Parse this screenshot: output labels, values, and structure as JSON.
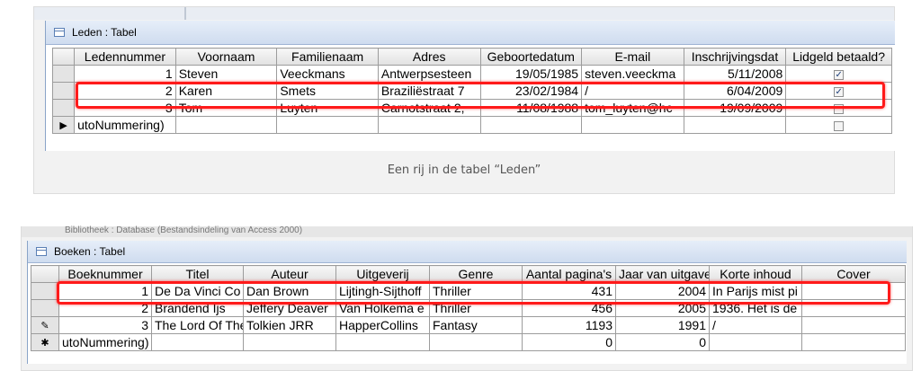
{
  "leden": {
    "window_title": "Leden : Tabel",
    "columns": [
      "Ledennummer",
      "Voornaam",
      "Familienaam",
      "Adres",
      "Geboortedatum",
      "E-mail",
      "Inschrijvingsdat",
      "Lidgeld betaald?"
    ],
    "rows": [
      {
        "nummer": "1",
        "voornaam": "Steven",
        "familienaam": "Veeckmans",
        "adres": "Antwerpsesteen",
        "geboortedatum": "19/05/1985",
        "email": "steven.veeckma",
        "inschrijving": "5/11/2008",
        "betaald": true
      },
      {
        "nummer": "2",
        "voornaam": "Karen",
        "familienaam": "Smets",
        "adres": "Braziliëstraat 7",
        "geboortedatum": "23/02/1984",
        "email": "/",
        "inschrijving": "6/04/2009",
        "betaald": true
      },
      {
        "nummer": "3",
        "voornaam": "Tom",
        "familienaam": "Luyten",
        "adres": "Carnotstraat 2,",
        "geboortedatum": "11/08/1988",
        "email": "tom_luyten@hc",
        "inschrijving": "19/09/2009",
        "betaald": false
      }
    ],
    "new_row": {
      "selector": "▶",
      "nummer": "utoNummering)"
    },
    "caption": "Een rij in de tabel “Leden”"
  },
  "boeken": {
    "behind_title": "Bibliotheek : Database (Bestandsindeling van Access 2000)",
    "window_title": "Boeken : Tabel",
    "columns": [
      "Boeknummer",
      "Titel",
      "Auteur",
      "Uitgeverij",
      "Genre",
      "Aantal pagina's",
      "Jaar van uitgave",
      "Korte inhoud",
      "Cover"
    ],
    "rows": [
      {
        "selector": "",
        "nummer": "1",
        "titel": "De Da Vinci Co",
        "auteur": "Dan Brown",
        "uitgeverij": "Lijtingh-Sijthoff",
        "genre": "Thriller",
        "paginas": "431",
        "jaar": "2004",
        "inhoud": "In Parijs mist pi",
        "cover": ""
      },
      {
        "selector": "",
        "nummer": "2",
        "titel": "Brandend Ijs",
        "auteur": "Jeffery Deaver",
        "uitgeverij": "Van Holkema e",
        "genre": "Thriller",
        "paginas": "456",
        "jaar": "2005",
        "inhoud": "1936. Het is de",
        "cover": ""
      },
      {
        "selector": "✎",
        "nummer": "3",
        "titel": "The Lord Of The",
        "auteur": "Tolkien JRR",
        "uitgeverij": "HapperCollins",
        "genre": "Fantasy",
        "paginas": "1193",
        "jaar": "1991",
        "inhoud": "/",
        "cover": ""
      }
    ],
    "new_row": {
      "selector": "✱",
      "nummer": "utoNummering)",
      "paginas": "0",
      "jaar": "0"
    }
  }
}
